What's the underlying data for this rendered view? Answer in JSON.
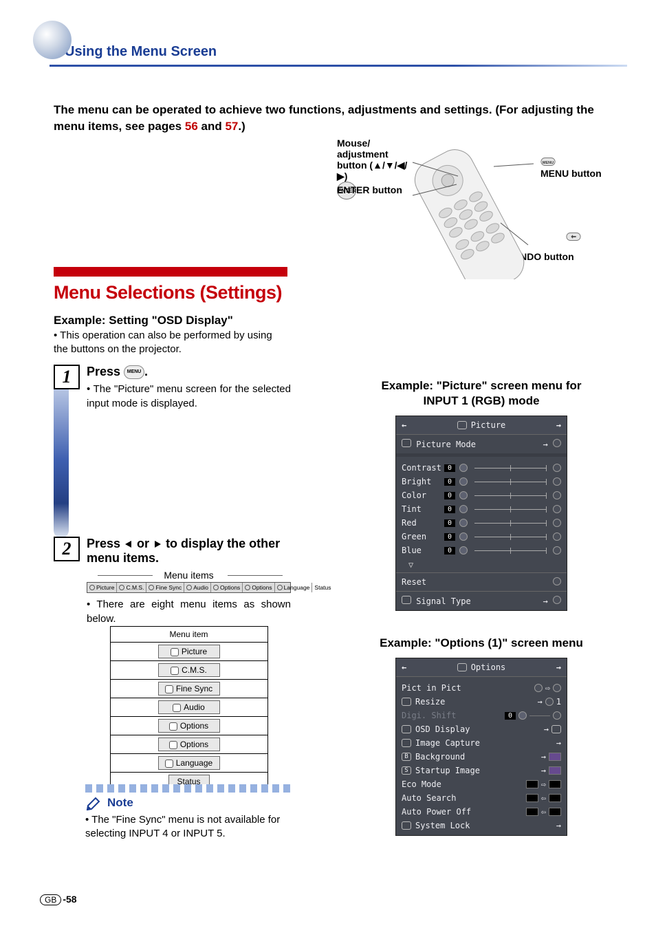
{
  "header": {
    "title": "Using the Menu Screen"
  },
  "intro": {
    "text_a": "The menu can be operated to achieve two functions, adjustments and settings. (For adjusting the menu items, see pages ",
    "link1": "56",
    "and": " and ",
    "link2": "57",
    "text_b": ".)"
  },
  "remote": {
    "mouse_line1": "Mouse/",
    "mouse_line2": "adjustment",
    "mouse_line3": "button (▲/▼/◀/▶)",
    "enter": "ENTER button",
    "menu": "MENU button",
    "undo": "UNDO button"
  },
  "menu_heading": "Menu Selections (Settings)",
  "example_setting": "Example: Setting \"OSD Display\"",
  "example_sub": "This operation can also be performed by using the buttons on the projector.",
  "steps": {
    "s1": {
      "num": "1",
      "title_a": "Press ",
      "title_b": ".",
      "desc": "The \"Picture\" menu screen for the selected input mode is displayed."
    },
    "s2": {
      "num": "2",
      "title_a": "Press ",
      "title_mid": " or ",
      "title_b": " to display the other menu items.",
      "caption": "Menu items",
      "desc": "There are eight menu items as shown below.",
      "table_header": "Menu item"
    }
  },
  "tab_strip": [
    "Picture",
    "C.M.S.",
    "Fine Sync",
    "Audio",
    "Options",
    "Options",
    "Language",
    "Status"
  ],
  "menu_items": [
    "Picture",
    "C.M.S.",
    "Fine Sync",
    "Audio",
    "Options",
    "Options",
    "Language",
    "Status"
  ],
  "note": {
    "label": "Note",
    "text": "The \"Fine Sync\" menu is not available for selecting INPUT 4 or INPUT 5."
  },
  "right": {
    "ex1_title_a": "Example: \"Picture\" screen menu for",
    "ex1_title_b": "INPUT 1 (RGB) mode",
    "ex2_title": "Example: \"Options (1)\" screen menu"
  },
  "picture_panel": {
    "title": "Picture",
    "mode": "Picture Mode",
    "rows": [
      {
        "label": "Contrast",
        "val": "0"
      },
      {
        "label": "Bright",
        "val": "0"
      },
      {
        "label": "Color",
        "val": "0"
      },
      {
        "label": "Tint",
        "val": "0"
      },
      {
        "label": "Red",
        "val": "0"
      },
      {
        "label": "Green",
        "val": "0"
      },
      {
        "label": "Blue",
        "val": "0"
      }
    ],
    "reset": "Reset",
    "signal": "Signal Type"
  },
  "options_panel": {
    "title": "Options",
    "rows": [
      {
        "label": "Pict in Pict",
        "type": "switch"
      },
      {
        "label": "Resize",
        "type": "arrow1"
      },
      {
        "label": "Digi. Shift",
        "type": "slider",
        "disabled": true,
        "val": "0"
      },
      {
        "label": "OSD Display",
        "type": "arrowico"
      },
      {
        "label": "Image Capture",
        "type": "arrow"
      },
      {
        "label": "Background",
        "type": "arrowchip"
      },
      {
        "label": "Startup Image",
        "type": "arrowchip"
      },
      {
        "label": "Eco Mode",
        "type": "switch2"
      },
      {
        "label": "Auto Search",
        "type": "switch3"
      },
      {
        "label": "Auto Power Off",
        "type": "switch3b"
      },
      {
        "label": "System Lock",
        "type": "arrow"
      }
    ]
  },
  "footer": {
    "gb": "GB",
    "page": "-58"
  }
}
